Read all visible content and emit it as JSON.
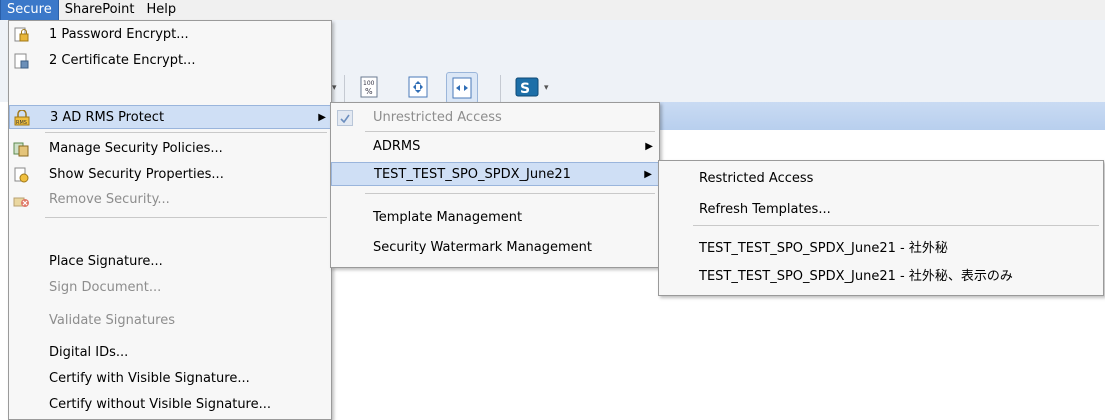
{
  "menubar": {
    "items": [
      "Secure",
      "SharePoint",
      "Help"
    ]
  },
  "secure_menu": {
    "items": [
      {
        "label": "1 Password Encrypt...",
        "icon": "password-lock-icon",
        "disabled": false
      },
      {
        "label": "2 Certificate Encrypt...",
        "icon": "certificate-icon",
        "disabled": false
      },
      {
        "label": "3 AD RMS Protect",
        "icon": "rms-lock-icon",
        "disabled": false,
        "highlighted": true,
        "submenu": true
      },
      {
        "label": "Manage Security Policies...",
        "icon": "policies-icon",
        "disabled": false
      },
      {
        "label": "Show Security Properties...",
        "icon": "properties-icon",
        "disabled": false
      },
      {
        "label": "Remove Security...",
        "icon": "remove-lock-icon",
        "disabled": true
      },
      {
        "label": "Place Signature...",
        "disabled": false
      },
      {
        "label": "Sign Document...",
        "disabled": true
      },
      {
        "label": "Validate Signatures",
        "disabled": true
      },
      {
        "label": "Digital IDs...",
        "disabled": false
      },
      {
        "label": "Certify with Visible Signature...",
        "disabled": false
      },
      {
        "label": "Certify without Visible Signature...",
        "disabled": false
      }
    ]
  },
  "rms_menu": {
    "items": [
      {
        "label": "Unrestricted Access",
        "checked": true,
        "disabled": true
      },
      {
        "label": "ADRMS",
        "submenu": true
      },
      {
        "label": "TEST_TEST_SPO_SPDX_June21",
        "submenu": true,
        "highlighted": true
      },
      {
        "label": "Template Management"
      },
      {
        "label": "Security Watermark Management"
      }
    ]
  },
  "template_menu": {
    "items": [
      {
        "label": "Restricted Access"
      },
      {
        "label": "Refresh Templates..."
      },
      {
        "label": "TEST_TEST_SPO_SPDX_June21 - 社外秘"
      },
      {
        "label": "TEST_TEST_SPO_SPDX_June21 - 社外秘、表示のみ"
      }
    ]
  },
  "toolbar": {
    "buttons": [
      {
        "icon": "zoom-percent-icon"
      },
      {
        "icon": "fit-page-icon"
      },
      {
        "icon": "fit-width-icon",
        "pressed": true
      },
      {
        "icon": "sharepoint-icon"
      }
    ]
  },
  "colors": {
    "menubar_active": "#3b78c9",
    "highlight": "#cfdff5",
    "disabled_text": "#8d8d8d"
  }
}
